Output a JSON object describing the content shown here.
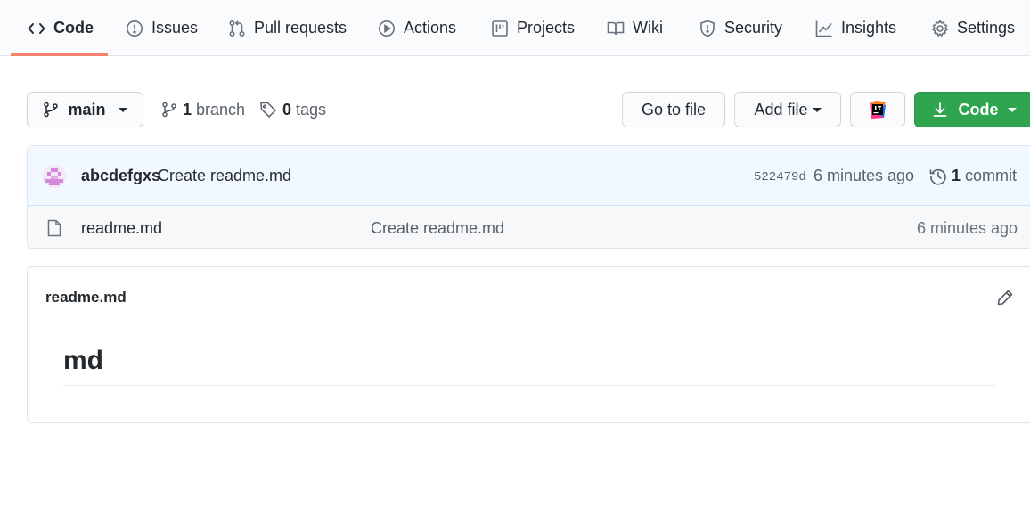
{
  "nav": {
    "tabs": [
      {
        "label": "Code",
        "icon": "code-icon",
        "active": true
      },
      {
        "label": "Issues",
        "icon": "issue-icon"
      },
      {
        "label": "Pull requests",
        "icon": "pull-request-icon"
      },
      {
        "label": "Actions",
        "icon": "play-icon"
      },
      {
        "label": "Projects",
        "icon": "project-icon"
      },
      {
        "label": "Wiki",
        "icon": "book-icon"
      },
      {
        "label": "Security",
        "icon": "shield-icon"
      },
      {
        "label": "Insights",
        "icon": "graph-icon"
      },
      {
        "label": "Settings",
        "icon": "gear-icon"
      }
    ],
    "active_underline_color": "#f9826c"
  },
  "toolbar": {
    "branch_selector": "main",
    "branch_count": "1",
    "branch_word": "branch",
    "tag_count": "0",
    "tag_word": "tags",
    "go_to_file": "Go to file",
    "add_file": "Add file",
    "code_button": "Code",
    "code_button_color": "#2ea44f"
  },
  "latest_commit": {
    "author": "abcdefgxs",
    "message": "Create readme.md",
    "sha": "522479d",
    "time": "6 minutes ago",
    "commit_count": "1",
    "commit_word": "commit"
  },
  "files": [
    {
      "name": "readme.md",
      "commit_message": "Create readme.md",
      "time": "6 minutes ago",
      "icon": "file-icon"
    }
  ],
  "readme": {
    "title": "readme.md",
    "heading": "md"
  }
}
